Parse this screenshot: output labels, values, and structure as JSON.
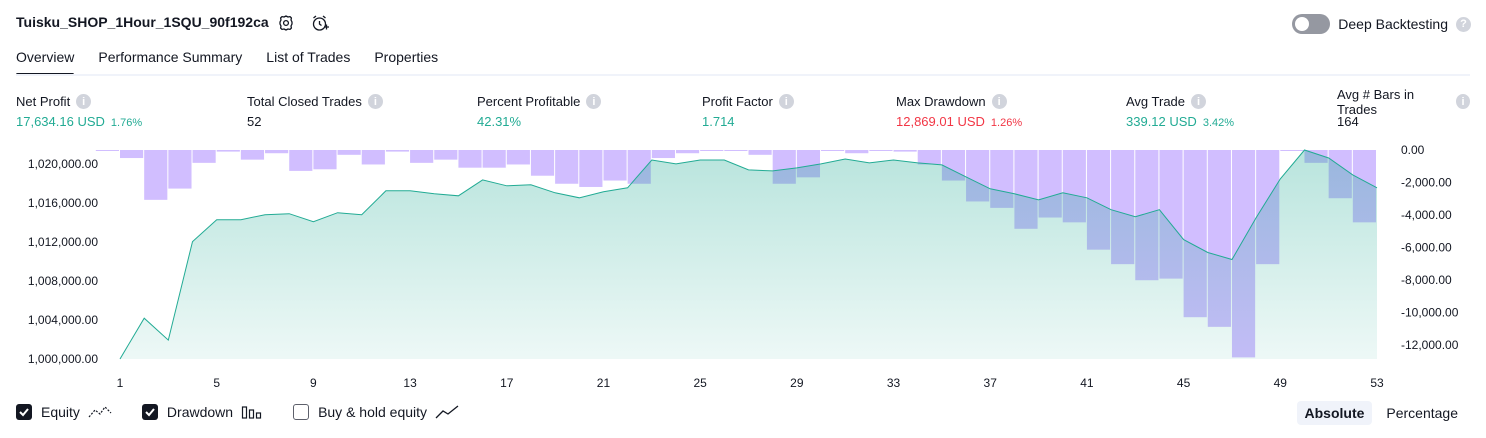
{
  "header": {
    "strategy_name": "Tuisku_SHOP_1Hour_1SQU_90f192ca",
    "settings_icon": "gear-icon",
    "alert_icon": "alarm-add-icon",
    "deep_backtesting_label": "Deep Backtesting",
    "deep_backtesting_on": false
  },
  "tabs": [
    {
      "label": "Overview",
      "active": true
    },
    {
      "label": "Performance Summary",
      "active": false
    },
    {
      "label": "List of Trades",
      "active": false
    },
    {
      "label": "Properties",
      "active": false
    }
  ],
  "metrics": [
    {
      "label": "Net Profit",
      "value": "17,634.16 USD",
      "pct": "1.76%",
      "color": "#22ab94"
    },
    {
      "label": "Total Closed Trades",
      "value": "52",
      "pct": "",
      "color": "#131722"
    },
    {
      "label": "Percent Profitable",
      "value": "42.31%",
      "pct": "",
      "color": "#22ab94"
    },
    {
      "label": "Profit Factor",
      "value": "1.714",
      "pct": "",
      "color": "#22ab94"
    },
    {
      "label": "Max Drawdown",
      "value": "12,869.01 USD",
      "pct": "1.26%",
      "color": "#f23645"
    },
    {
      "label": "Avg Trade",
      "value": "339.12 USD",
      "pct": "3.42%",
      "color": "#22ab94"
    },
    {
      "label": "Avg # Bars in Trades",
      "value": "164",
      "pct": "",
      "color": "#131722"
    }
  ],
  "chart_data": {
    "type": "area",
    "x_tick_labels": [
      "1",
      "5",
      "9",
      "13",
      "17",
      "21",
      "25",
      "29",
      "33",
      "37",
      "41",
      "45",
      "49",
      "53"
    ],
    "left_axis_ticks": [
      "1,020,000.00",
      "1,016,000.00",
      "1,012,000.00",
      "1,008,000.00",
      "1,004,000.00",
      "1,000,000.00"
    ],
    "right_axis_ticks": [
      "0.00",
      "-2,000.00",
      "-4,000.00",
      "-6,000.00",
      "-8,000.00",
      "-10,000.00",
      "-12,000.00"
    ],
    "equity_ylim": [
      1000000,
      1021000
    ],
    "drawdown_ylim": [
      -13000,
      0
    ],
    "x": [
      1,
      2,
      3,
      4,
      5,
      6,
      7,
      8,
      9,
      10,
      11,
      12,
      13,
      14,
      15,
      16,
      17,
      18,
      19,
      20,
      21,
      22,
      23,
      24,
      25,
      26,
      27,
      28,
      29,
      30,
      31,
      32,
      33,
      34,
      35,
      36,
      37,
      38,
      39,
      40,
      41,
      42,
      43,
      44,
      45,
      46,
      47,
      48,
      49,
      50,
      51,
      52,
      53
    ],
    "series": [
      {
        "name": "Equity",
        "values": [
          1000000,
          1004100,
          1001900,
          1011800,
          1014000,
          1014000,
          1014500,
          1014600,
          1013800,
          1014700,
          1014500,
          1016900,
          1016900,
          1016600,
          1016400,
          1018000,
          1017400,
          1017500,
          1016700,
          1016200,
          1016800,
          1017200,
          1020000,
          1019600,
          1020000,
          1020000,
          1019000,
          1018900,
          1019200,
          1019600,
          1020100,
          1019700,
          1020000,
          1019700,
          1019500,
          1018300,
          1017100,
          1016600,
          1016000,
          1016700,
          1016200,
          1015000,
          1014300,
          1015000,
          1012000,
          1010700,
          1010000,
          1014200,
          1018100,
          1021000,
          1020200,
          1018500,
          1017200
        ],
        "color": "#22ab94"
      },
      {
        "name": "Drawdown",
        "values": [
          0,
          -500,
          -3100,
          -2400,
          -800,
          -100,
          -600,
          -200,
          -1300,
          -1200,
          -300,
          -900,
          -100,
          -800,
          -600,
          -1100,
          -1100,
          -900,
          -1600,
          -2100,
          -2300,
          -1900,
          -2100,
          -500,
          -200,
          0,
          0,
          -300,
          -2100,
          -1700,
          0,
          -200,
          0,
          -100,
          -900,
          -1900,
          -3200,
          -3600,
          -4900,
          -4200,
          -4500,
          -6200,
          -7100,
          -8100,
          -8000,
          -10400,
          -11000,
          -12900,
          -7100,
          0,
          -800,
          -3000,
          -4500
        ],
        "color": "#c9b3ff"
      }
    ],
    "legend": [
      {
        "label": "Equity",
        "checked": true,
        "icon": "equity-line-icon"
      },
      {
        "label": "Drawdown",
        "checked": true,
        "icon": "drawdown-bars-icon"
      },
      {
        "label": "Buy & hold equity",
        "checked": false,
        "icon": "buy-hold-line-icon"
      }
    ],
    "scale_modes": [
      {
        "label": "Absolute",
        "active": true
      },
      {
        "label": "Percentage",
        "active": false
      }
    ]
  }
}
